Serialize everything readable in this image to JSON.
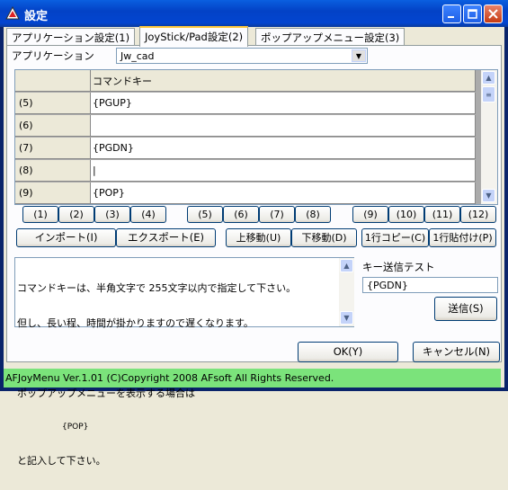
{
  "window": {
    "title": "設定"
  },
  "tabs": [
    {
      "label": "アプリケーション設定(1)"
    },
    {
      "label": "JoyStick/Pad設定(2)"
    },
    {
      "label": "ポップアップメニュー設定(3)"
    }
  ],
  "app": {
    "label": "アプリケーション",
    "selected": "Jw_cad"
  },
  "grid": {
    "header": "コマンドキー",
    "rows": [
      {
        "key": "(5)",
        "value": "{PGUP}"
      },
      {
        "key": "(6)",
        "value": ""
      },
      {
        "key": "(7)",
        "value": "{PGDN}"
      },
      {
        "key": "(8)",
        "value": "|"
      },
      {
        "key": "(9)",
        "value": "{POP}"
      }
    ]
  },
  "numbuttons": [
    "(1)",
    "(2)",
    "(3)",
    "(4)",
    "(5)",
    "(6)",
    "(7)",
    "(8)",
    "(9)",
    "(10)",
    "(11)",
    "(12)"
  ],
  "actions": {
    "import": "インポート(I)",
    "export": "エクスポート(E)",
    "moveup": "上移動(U)",
    "movedown": "下移動(D)",
    "copyrow": "1行コピー(C)",
    "pasterow": "1行貼付け(P)"
  },
  "help": {
    "line1": "コマンドキーは、半角文字で 255文字以内で指定して下さい。",
    "line2": "但し、長い程、時間が掛かりますので遅くなります。",
    "line3": "",
    "line4": "ポップアップメニューを表示する場合は",
    "line5": "{POP}",
    "line6": "と記入して下さい。"
  },
  "keytest": {
    "label": "キー送信テスト",
    "value": "{PGDN}",
    "send": "送信(S)"
  },
  "footer": {
    "ok": "OK(Y)",
    "cancel": "キャンセル(N)"
  },
  "status": "AFJoyMenu Ver.1.01 (C)Copyright 2008 AFsoft All Rights Reserved."
}
